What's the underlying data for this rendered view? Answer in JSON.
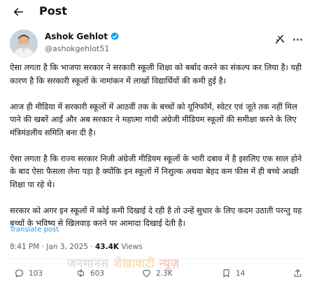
{
  "header": {
    "title": "Post"
  },
  "author": {
    "name": "Ashok Gehlot",
    "handle": "@ashokgehlot51"
  },
  "post": {
    "paragraphs": [
      "ऐसा लगता है कि भाजपा सरकार ने सरकारी स्कूली शिक्षा को बर्बाद करने का संकल्प कर लिया है। यही कारण है कि सरकारी स्कूलों के नामांकन में लाखों विद्यार्थियों की कमी हुई है।",
      "आज ही मीडिया में सरकारी स्कूलों में आठवीं तक के बच्चों को यूनिफॉर्म, स्वेटर एवं जूते तक नहीं मिल पाने की खबरें आईं और अब सरकार ने महात्मा गांधी अंग्रेजी मीडियम स्कूलों की समीक्षा करने के लिए मंत्रिमंडलीय समिति बना दी है।",
      "ऐसा लगता है कि राज्य सरकार निजी अंग्रेजी मीडियम स्कूलों के भारी दबाव में है इसलिए एक साल होने के बाद ऐसा फैसला लेना पड़ा है क्योंकि इन स्कूलों में निशुल्क अथवा बेहद कम फीस में ही बच्चे अच्छी शिक्षा पा रहे थे।",
      "सरकार को अगर इन स्कूलों में कोई कमी दिखाई दे रही है तो उन्हें सुधार के लिए कदम उठाती परन्तु यह बच्चों के भविष्य से खिलवाड़ करने पर आमादा दिखाई देती है।"
    ],
    "translate_label": "Translate post"
  },
  "meta": {
    "time": "8:41 PM",
    "date": "Jan 3, 2025",
    "views_count": "43.4K",
    "views_label": "Views"
  },
  "actions": {
    "replies": "103",
    "reposts": "603",
    "likes": "2.3K",
    "bookmarks": "14"
  },
  "watermark": {
    "part1": "जनमानस",
    "part2": "शेखावाटी",
    "part3": "न्यूज़"
  },
  "colors": {
    "link": "#1d9bf0",
    "muted": "#536471",
    "text": "#0f1419",
    "verified": "#1d9bf0"
  }
}
